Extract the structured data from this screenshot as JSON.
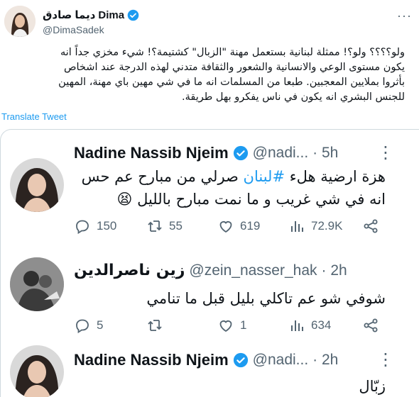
{
  "header": {
    "display_name_ar": "ديما صادق",
    "display_name_en": "Dima",
    "handle": "@DimaSadek",
    "more_icon": "more-icon"
  },
  "tweet": {
    "lines": [
      "ولو؟؟؟؟ ولو؟! ممثلة لبنانية  بستعمل مهنة \"الزبال\" كشتيمة؟! شيء مخزي جداً انه",
      "يكون  مستوى الوعي والانسانية والشعور والثقافة متدني لهذه الدرجة عند اشخاص",
      "بأثروا بملايين المعجبين. طبعا من المسلمات انه ما في شي مهين باي مهنة، المهين",
      "للجنس البشري انه يكون في ناس يفكرو بهل طريقة."
    ],
    "translate_label": "Translate Tweet"
  },
  "replies": [
    {
      "name": "Nadine Nassib Njeim",
      "handle": "@nadi...",
      "time": "· 5h",
      "text_before": "هزة ارضية هلء ",
      "hashtag": "#لبنان",
      "text_after": " صرلي من مبارح عم حس",
      "line2": "انه في شي غريب و ما نمت مبارح بالليل 😫",
      "stats": {
        "replies": "150",
        "retweets": "55",
        "likes": "619",
        "views": "72.9K"
      }
    },
    {
      "name": "زين ناصرالدين",
      "handle": "@zein_nasser_hak",
      "time": "· 2h",
      "line1": "شوفي شو عم تاكلي بليل قبل ما تنامي",
      "stats": {
        "replies": "5",
        "retweets": "",
        "likes": "1",
        "views": "634"
      }
    },
    {
      "name": "Nadine Nassib Njeim",
      "handle": "@nadi...",
      "time": "· 2h",
      "line1": "زبّال"
    }
  ],
  "colors": {
    "accent": "#1d9bf0",
    "muted": "#536471",
    "text": "#0f1419",
    "border": "#cfd9de"
  }
}
